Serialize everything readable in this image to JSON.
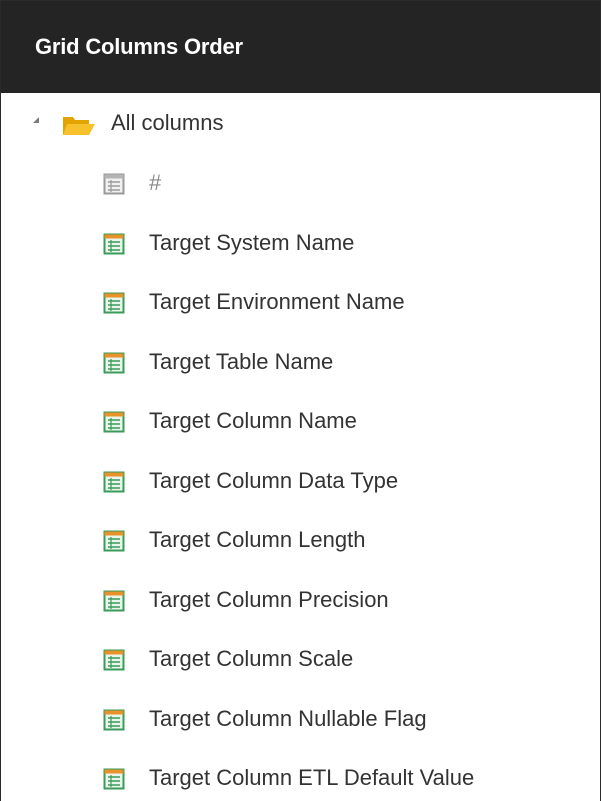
{
  "header": {
    "title": "Grid Columns Order"
  },
  "tree": {
    "root": {
      "label": "All columns",
      "expanded": true,
      "icon": "open-folder-icon"
    },
    "items": [
      {
        "label": "#",
        "icon": "column-icon",
        "enabled": false
      },
      {
        "label": "Target System Name",
        "icon": "column-icon",
        "enabled": true
      },
      {
        "label": "Target Environment Name",
        "icon": "column-icon",
        "enabled": true
      },
      {
        "label": "Target Table Name",
        "icon": "column-icon",
        "enabled": true
      },
      {
        "label": "Target Column Name",
        "icon": "column-icon",
        "enabled": true
      },
      {
        "label": "Target Column Data Type",
        "icon": "column-icon",
        "enabled": true
      },
      {
        "label": "Target Column Length",
        "icon": "column-icon",
        "enabled": true
      },
      {
        "label": "Target Column Precision",
        "icon": "column-icon",
        "enabled": true
      },
      {
        "label": "Target Column Scale",
        "icon": "column-icon",
        "enabled": true
      },
      {
        "label": "Target Column Nullable Flag",
        "icon": "column-icon",
        "enabled": true
      },
      {
        "label": "Target Column ETL Default Value",
        "icon": "column-icon",
        "enabled": true
      }
    ]
  },
  "colors": {
    "header_bg": "#242424",
    "header_text": "#ffffff",
    "text": "#333333",
    "disabled_text": "#8a8a8a",
    "folder": "#f5b400",
    "icon_green": "#3a9b5a",
    "icon_orange": "#e8922a"
  }
}
